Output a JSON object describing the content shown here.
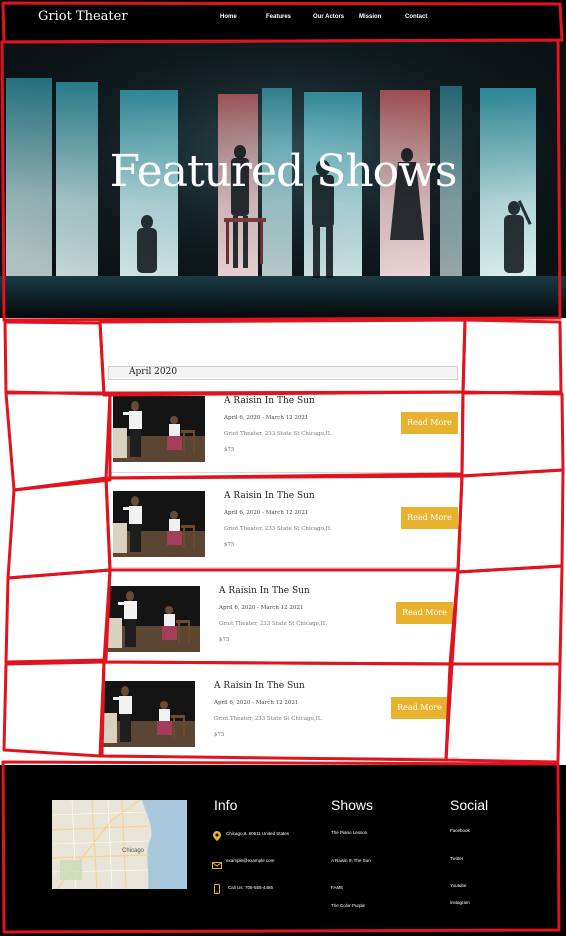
{
  "nav": {
    "brand": "Griot Theater",
    "links": [
      "Home",
      "Features",
      "Our Actors",
      "Mission",
      "Contact"
    ]
  },
  "hero": {
    "title": "Featured Shows"
  },
  "shows": {
    "month": "April 2020",
    "items": [
      {
        "title": "A Raisin In The Sun",
        "dates": "April 6, 2020 - March 12 2021",
        "venue": "Griot Theater, 233 State St Chicago,IL",
        "price": "$75",
        "button": "Read More"
      },
      {
        "title": "A Raisin In The Sun",
        "dates": "April 6, 2020 - March 12 2021",
        "venue": "Griot Theater, 233 State St Chicago,IL",
        "price": "$75",
        "button": "Read More"
      },
      {
        "title": "A Raisin In The Sun",
        "dates": "April 6, 2020 - March 12 2021",
        "venue": "Griot Theater, 233 State St Chicago,IL",
        "price": "$75",
        "button": "Read More"
      },
      {
        "title": "A Raisin In The Sun",
        "dates": "April 6, 2020 - March 12 2021",
        "venue": "Griot Theater, 233 State St Chicago,IL",
        "price": "$75",
        "button": "Read More"
      }
    ]
  },
  "footer": {
    "info": {
      "heading": "Info",
      "address": "Chicago,IL 60611 United States",
      "email": "example@example.com",
      "phone": "Call Us: 708-555-4465"
    },
    "shows": {
      "heading": "Shows",
      "items": [
        "The Piano Lesson",
        "A Raisin In The Sun",
        "FAME",
        "The Color Purple"
      ]
    },
    "social": {
      "heading": "Social",
      "items": [
        "Facebook",
        "Twitter",
        "Youtube",
        "instagram"
      ]
    },
    "map_label": "Chicago"
  },
  "colors": {
    "accent": "#e8b22e",
    "nav_bg": "#000000",
    "footer_bg": "#000000",
    "sketch": "#e0141e"
  },
  "icons": {
    "address": "map-pin-icon",
    "email": "envelope-icon",
    "phone": "phone-icon"
  }
}
